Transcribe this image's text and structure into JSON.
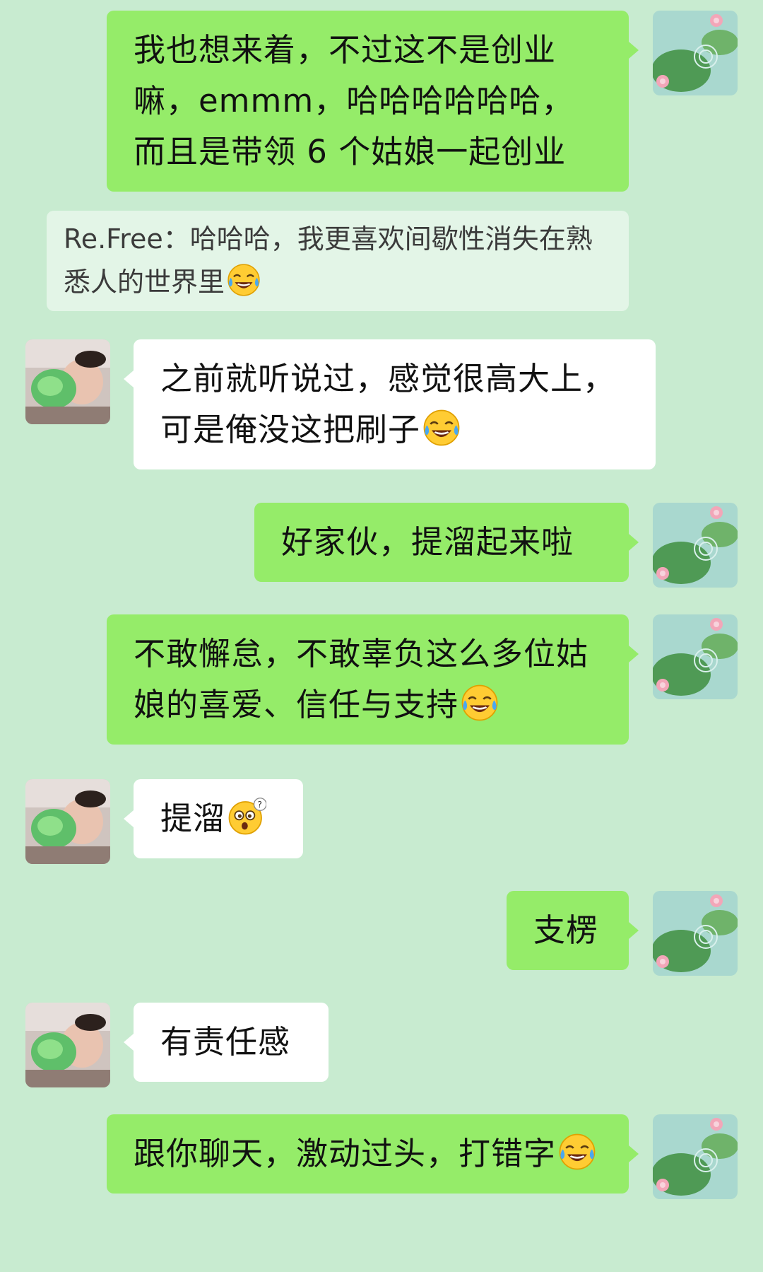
{
  "messages": [
    {
      "id": 1,
      "side": "me",
      "text": "我也想来着，不过这不是创业嘛，emmm，哈哈哈哈哈哈，而且是带领 6 个姑娘一起创业",
      "emoji": null
    },
    {
      "id": 2,
      "side": "quote",
      "text": "Re.Free：哈哈哈，我更喜欢间歇性消失在熟悉人的世界里",
      "emoji": "tears-of-joy"
    },
    {
      "id": 3,
      "side": "other",
      "text": "之前就听说过，感觉很高大上，可是俺没这把刷子",
      "emoji": "tears-of-joy"
    },
    {
      "id": 4,
      "side": "me",
      "text": "好家伙，提溜起来啦",
      "emoji": null
    },
    {
      "id": 5,
      "side": "me",
      "text": "不敢懈怠，不敢辜负这么多位姑娘的喜爱、信任与支持",
      "emoji": "tears-of-joy"
    },
    {
      "id": 6,
      "side": "other",
      "text": "提溜",
      "emoji": "dizzy-question"
    },
    {
      "id": 7,
      "side": "me",
      "text": "支楞",
      "emoji": null
    },
    {
      "id": 8,
      "side": "other",
      "text": "有责任感",
      "emoji": null
    },
    {
      "id": 9,
      "side": "me",
      "text": "跟你聊天，激动过头，打错字",
      "emoji": "tears-of-joy"
    }
  ],
  "avatars": {
    "me": "lotus-pond-avatar",
    "other": "child-with-green-toy-avatar"
  },
  "colors": {
    "background": "#c8ebd0",
    "my_bubble": "#95ec69",
    "other_bubble": "#ffffff",
    "quote_bubble": "#e3f5e7"
  }
}
